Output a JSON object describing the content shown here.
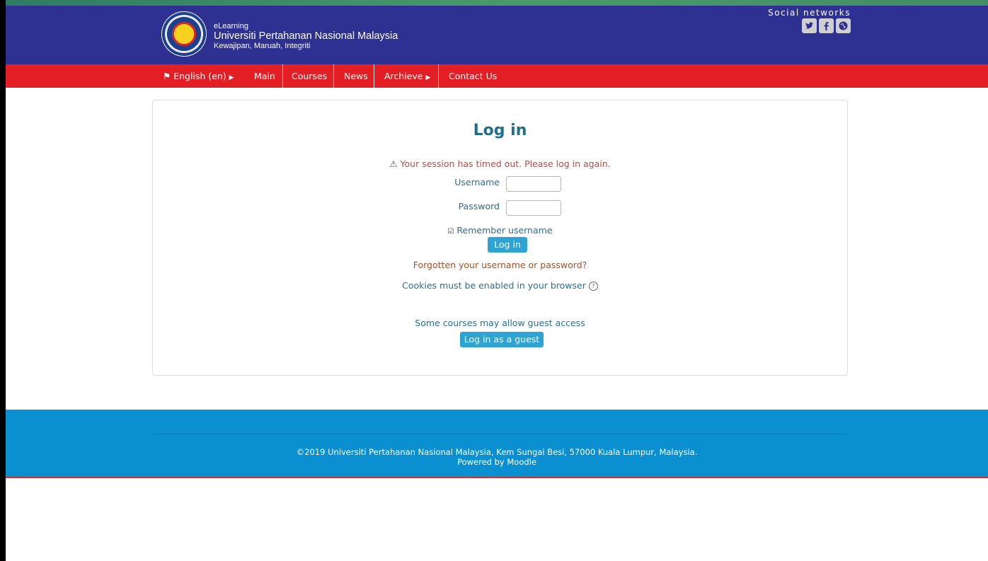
{
  "header": {
    "brand_small": "eLearning",
    "brand_big": "Universiti Pertahanan Nasional Malaysia",
    "tagline": "Kewajipan, Maruah, Integriti",
    "social_title": "Social networks",
    "social_icons": [
      "twitter-icon",
      "facebook-icon",
      "globe-icon"
    ]
  },
  "nav": {
    "language": "English (en)",
    "items": [
      "Main",
      "Courses",
      "News",
      "Archieve",
      "Contact Us"
    ]
  },
  "login": {
    "title": "Log in",
    "session_warning": "Your session has timed out. Please log in again.",
    "username_label": "Username",
    "username_value": "",
    "password_label": "Password",
    "password_value": "",
    "remember_label": "Remember username",
    "remember_checked": true,
    "login_button": "Log in",
    "forgot_link": "Forgotten your username or password?",
    "cookies_text": "Cookies must be enabled in your browser",
    "guest_text": "Some courses may allow guest access",
    "guest_button": "Log in as a guest"
  },
  "footer": {
    "copyright": "©2019 Universiti Pertahanan Nasional Malaysia, Kem Sungai Besi, 57000 Kuala Lumpur, Malaysia.",
    "powered": "Powered by Moodle"
  },
  "colors": {
    "header_bg": "#2e3192",
    "nav_bg": "#e31e24",
    "button": "#2fa4d4",
    "footer_bg": "#0a8fd0"
  }
}
